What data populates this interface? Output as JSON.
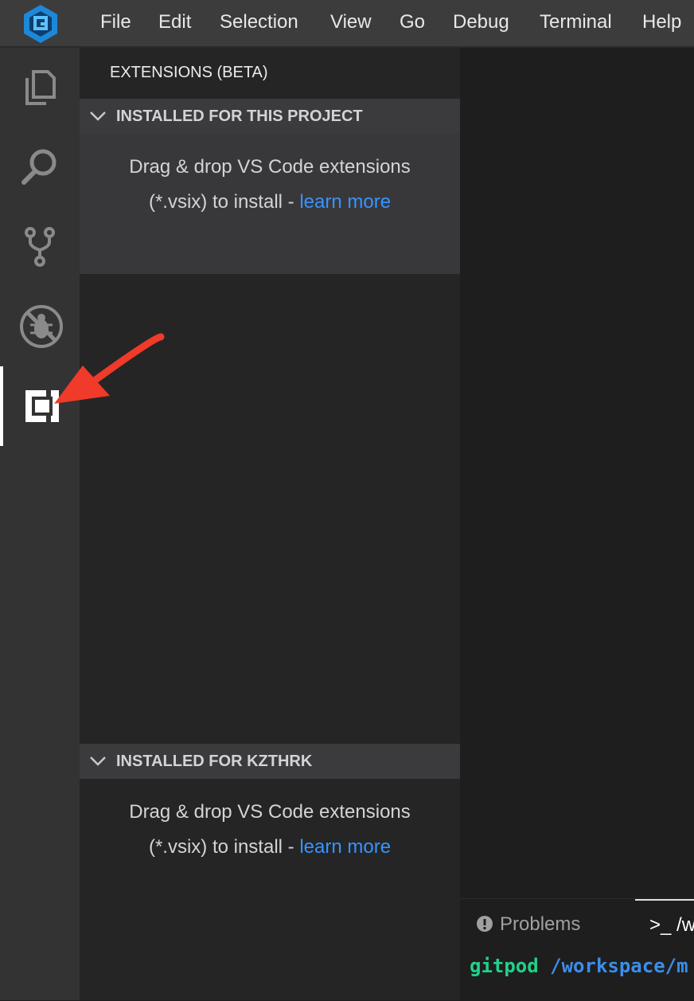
{
  "menu": {
    "items": [
      "File",
      "Edit",
      "Selection",
      "View",
      "Go",
      "Debug",
      "Terminal",
      "Help"
    ]
  },
  "activity_bar": {
    "items": [
      "files-icon",
      "search-icon",
      "source-control-icon",
      "debug-icon",
      "extensions-icon"
    ],
    "active": "extensions-icon"
  },
  "sidebar": {
    "title": "EXTENSIONS (BETA)",
    "sections": [
      {
        "header": "INSTALLED FOR THIS PROJECT",
        "line1": "Drag & drop VS Code extensions",
        "line2_prefix": "(*.vsix) to install - ",
        "link": "learn more"
      },
      {
        "header": "INSTALLED FOR KZTHRK",
        "line1": "Drag & drop VS Code extensions",
        "line2_prefix": "(*.vsix) to install - ",
        "link": "learn more"
      }
    ]
  },
  "panel": {
    "tabs": [
      "Problems",
      ">_ /w"
    ],
    "terminal": {
      "user": "gitpod",
      "path": "/workspace/m"
    }
  },
  "colors": {
    "accent_link": "#3794ff",
    "annotation_arrow": "#f03a2a",
    "terminal_user": "#23d18b",
    "terminal_path": "#3b8eea"
  }
}
